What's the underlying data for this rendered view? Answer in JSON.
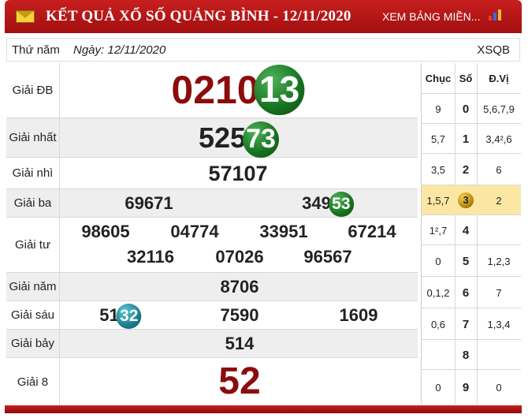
{
  "header": {
    "title": "KẾT QUẢ XỔ SỐ QUẢNG BÌNH - 12/11/2020",
    "more_link": "XEM BẢNG MIỀN...",
    "icon": "mail-icon",
    "brand_color": "#b5161a"
  },
  "info": {
    "day": "Thứ năm",
    "date": "Ngày: 12/11/2020",
    "code": "XSQB"
  },
  "prizes": [
    {
      "label": "Giải ĐB",
      "numbers": [
        {
          "text": "0210",
          "ball": "13"
        }
      ]
    },
    {
      "label": "Giải nhất",
      "numbers": [
        {
          "text": "525",
          "ball": "73"
        }
      ]
    },
    {
      "label": "Giải nhì",
      "numbers": [
        {
          "text": "57107"
        }
      ]
    },
    {
      "label": "Giải ba",
      "numbers": [
        {
          "text": "69671"
        },
        {
          "text": "349",
          "ball": "53"
        }
      ]
    },
    {
      "label": "Giải tư",
      "numbers": [
        {
          "text": "98605"
        },
        {
          "text": "04774"
        },
        {
          "text": "33951"
        },
        {
          "text": "67214"
        },
        {
          "text": "32116"
        },
        {
          "text": "07026"
        },
        {
          "text": "96567"
        }
      ]
    },
    {
      "label": "Giải năm",
      "numbers": [
        {
          "text": "8706"
        }
      ]
    },
    {
      "label": "Giải sáu",
      "numbers": [
        {
          "text": "51",
          "ball": "32"
        },
        {
          "text": "7590"
        },
        {
          "text": "1609"
        }
      ]
    },
    {
      "label": "Giải bảy",
      "numbers": [
        {
          "text": "514"
        }
      ]
    },
    {
      "label": "Giải 8",
      "numbers": [
        {
          "text": "52"
        }
      ]
    }
  ],
  "loto": {
    "headers": [
      "Chục",
      "Số",
      "Đ.Vị"
    ],
    "rows": [
      {
        "chuc": "9",
        "so": "0",
        "dvi": "5,6,7,9"
      },
      {
        "chuc": "5,7",
        "so": "1",
        "dvi": "3,4²,6"
      },
      {
        "chuc": "3,5",
        "so": "2",
        "dvi": "6"
      },
      {
        "chuc": "1,5,7",
        "so": "3",
        "dvi": "2",
        "highlight": true
      },
      {
        "chuc": "1²,7",
        "so": "4",
        "dvi": ""
      },
      {
        "chuc": "0",
        "so": "5",
        "dvi": "1,2,3"
      },
      {
        "chuc": "0,1,2",
        "so": "6",
        "dvi": "7"
      },
      {
        "chuc": "0,6",
        "so": "7",
        "dvi": "1,3,4"
      },
      {
        "chuc": "",
        "so": "8",
        "dvi": ""
      },
      {
        "chuc": "0",
        "so": "9",
        "dvi": "0"
      }
    ]
  },
  "colors": {
    "special_red": "#8b0c0c",
    "ball_green": "#16711f",
    "ball_teal": "#1d7d8d",
    "highlight": "#fbe7a3"
  }
}
